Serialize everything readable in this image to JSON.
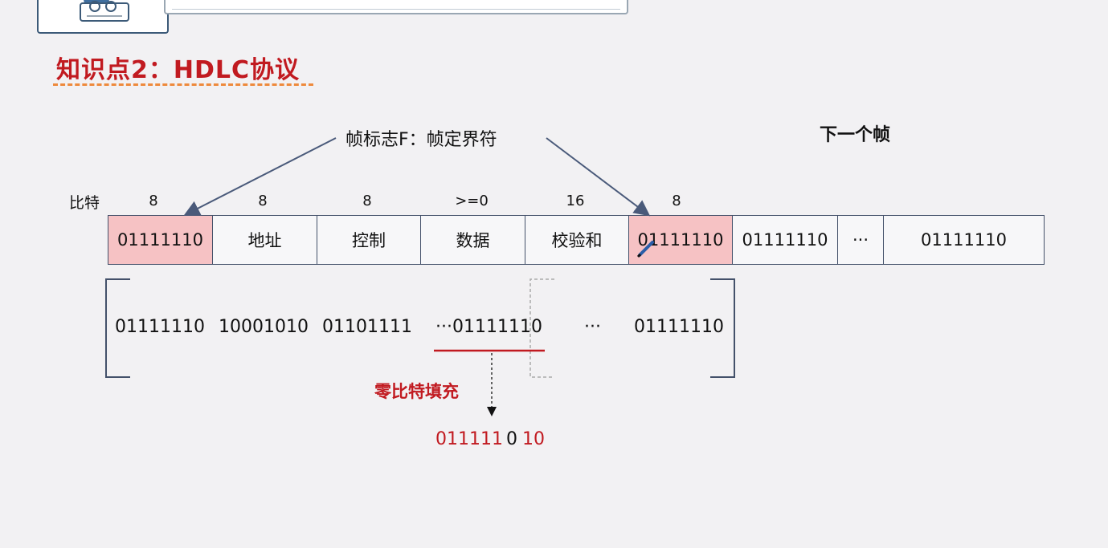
{
  "title": "知识点2：HDLC协议",
  "flag_annotation": "帧标志F：帧定界符",
  "next_frame_label": "下一个帧",
  "bits_label": "比特",
  "bit_sizes": [
    "8",
    "8",
    "8",
    ">=0",
    "16",
    "8"
  ],
  "frame_fields": [
    {
      "label": "01111110",
      "highlight": true
    },
    {
      "label": "地址",
      "highlight": false
    },
    {
      "label": "控制",
      "highlight": false
    },
    {
      "label": "数据",
      "highlight": false
    },
    {
      "label": "校验和",
      "highlight": false
    },
    {
      "label": "01111110",
      "highlight": true
    },
    {
      "label": "01111110",
      "highlight": false
    },
    {
      "label": "···",
      "highlight": false
    },
    {
      "label": "01111110",
      "highlight": false
    }
  ],
  "bit_sequence": [
    "01111110",
    "10001010",
    "01101111",
    "···01111110",
    "···",
    "01111110"
  ],
  "zero_stuffing_label": "零比特填充",
  "stuffed_result": {
    "before": "011111",
    "inserted": "0",
    "after": "10"
  },
  "colors": {
    "accent_red": "#c11a20",
    "flag_fill": "#f6c2c4",
    "underline_orange": "#ee8a3c"
  }
}
